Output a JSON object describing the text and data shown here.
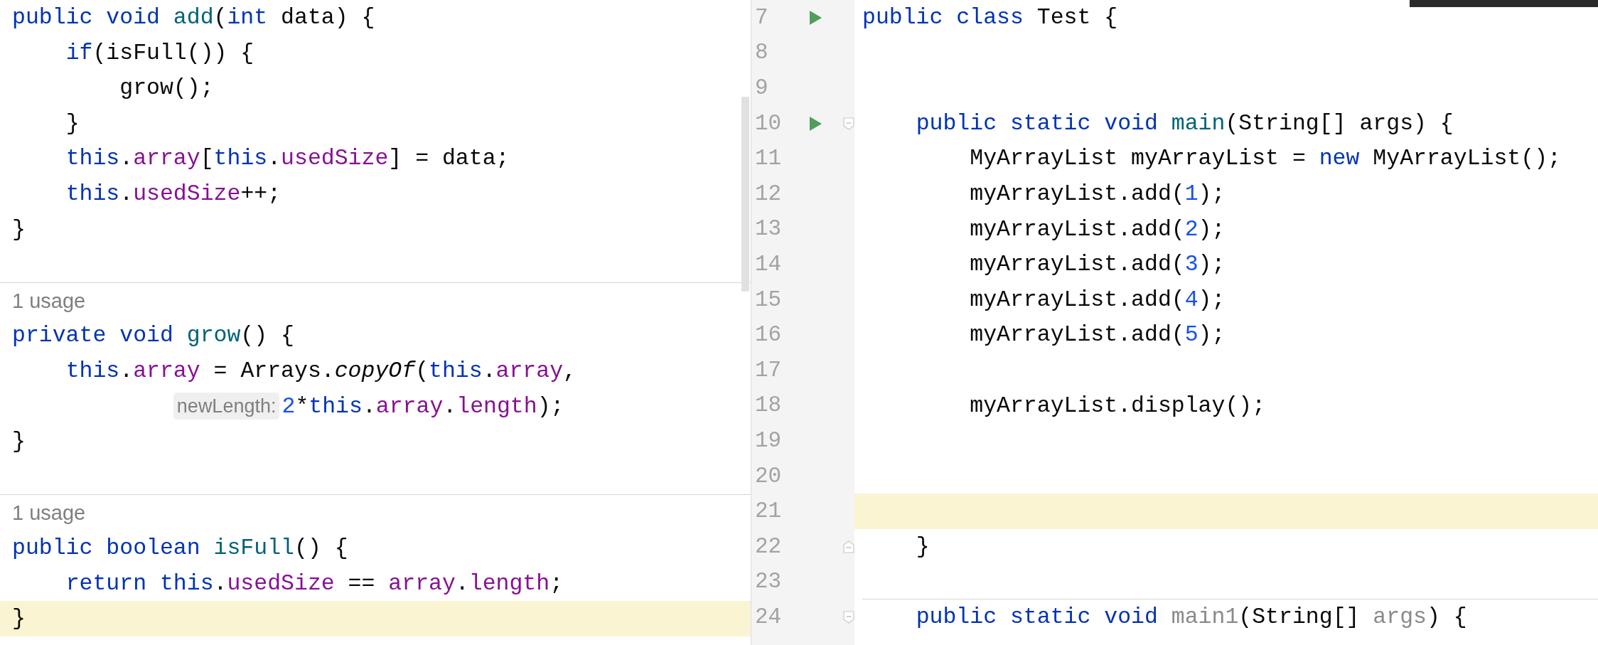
{
  "preview": {
    "blocks": [
      {
        "lines": [
          {
            "current": false,
            "tokens": [
              {
                "text": "public",
                "kind": "keyword"
              },
              {
                "text": " void",
                "kind": "keyword"
              },
              {
                "text": " add",
                "kind": "declaration"
              },
              {
                "text": "(",
                "kind": "plain"
              },
              {
                "text": "int",
                "kind": "keyword"
              },
              {
                "text": " data) {",
                "kind": "plain"
              }
            ]
          },
          {
            "current": false,
            "tokens": [
              {
                "text": "    if",
                "kind": "keyword"
              },
              {
                "text": "(isFull()) {",
                "kind": "plain"
              }
            ]
          },
          {
            "current": false,
            "tokens": [
              {
                "text": "        grow();",
                "kind": "plain"
              }
            ]
          },
          {
            "current": false,
            "tokens": [
              {
                "text": "    }",
                "kind": "plain"
              }
            ]
          },
          {
            "current": false,
            "tokens": [
              {
                "text": "    this",
                "kind": "keyword"
              },
              {
                "text": ".",
                "kind": "plain"
              },
              {
                "text": "array",
                "kind": "field"
              },
              {
                "text": "[",
                "kind": "plain"
              },
              {
                "text": "this",
                "kind": "keyword"
              },
              {
                "text": ".",
                "kind": "plain"
              },
              {
                "text": "usedSize",
                "kind": "field"
              },
              {
                "text": "] = data;",
                "kind": "plain"
              }
            ]
          },
          {
            "current": false,
            "tokens": [
              {
                "text": "    this",
                "kind": "keyword"
              },
              {
                "text": ".",
                "kind": "plain"
              },
              {
                "text": "usedSize",
                "kind": "field"
              },
              {
                "text": "++;",
                "kind": "plain"
              }
            ]
          },
          {
            "current": false,
            "tokens": [
              {
                "text": "}",
                "kind": "plain"
              }
            ]
          }
        ]
      },
      {
        "usage": "1 usage",
        "lines": [
          {
            "current": false,
            "tokens": [
              {
                "text": "private",
                "kind": "keyword"
              },
              {
                "text": " void",
                "kind": "keyword"
              },
              {
                "text": " grow",
                "kind": "declaration"
              },
              {
                "text": "() {",
                "kind": "plain"
              }
            ]
          },
          {
            "current": false,
            "tokens": [
              {
                "text": "    this",
                "kind": "keyword"
              },
              {
                "text": ".",
                "kind": "plain"
              },
              {
                "text": "array",
                "kind": "field"
              },
              {
                "text": " = Arrays.",
                "kind": "plain"
              },
              {
                "text": "copyOf",
                "kind": "static_call"
              },
              {
                "text": "(",
                "kind": "plain"
              },
              {
                "text": "this",
                "kind": "keyword"
              },
              {
                "text": ".",
                "kind": "plain"
              },
              {
                "text": "array",
                "kind": "field"
              },
              {
                "text": ",",
                "kind": "plain"
              }
            ]
          },
          {
            "current": false,
            "tokens": [
              {
                "text": "            newLength:",
                "kind": "hint"
              },
              {
                "text": "2",
                "kind": "number"
              },
              {
                "text": "*",
                "kind": "plain"
              },
              {
                "text": "this",
                "kind": "keyword"
              },
              {
                "text": ".",
                "kind": "plain"
              },
              {
                "text": "array",
                "kind": "field"
              },
              {
                "text": ".",
                "kind": "plain"
              },
              {
                "text": "length",
                "kind": "field"
              },
              {
                "text": ");",
                "kind": "plain"
              }
            ]
          },
          {
            "current": false,
            "tokens": [
              {
                "text": "}",
                "kind": "plain"
              }
            ]
          }
        ]
      },
      {
        "usage": "1 usage",
        "lines": [
          {
            "current": false,
            "tokens": [
              {
                "text": "public",
                "kind": "keyword"
              },
              {
                "text": " boolean",
                "kind": "keyword"
              },
              {
                "text": " isFull",
                "kind": "declaration"
              },
              {
                "text": "() {",
                "kind": "plain"
              }
            ]
          },
          {
            "current": false,
            "tokens": [
              {
                "text": "    return",
                "kind": "keyword"
              },
              {
                "text": " this",
                "kind": "keyword"
              },
              {
                "text": ".",
                "kind": "plain"
              },
              {
                "text": "usedSize",
                "kind": "field"
              },
              {
                "text": " == ",
                "kind": "plain"
              },
              {
                "text": "array",
                "kind": "field"
              },
              {
                "text": ".",
                "kind": "plain"
              },
              {
                "text": "length",
                "kind": "field"
              },
              {
                "text": ";",
                "kind": "plain"
              }
            ]
          },
          {
            "current": true,
            "tokens": [
              {
                "text": "}",
                "kind": "plain"
              }
            ]
          }
        ]
      }
    ]
  },
  "editor": {
    "lines": [
      {
        "number": "7",
        "run": true,
        "fold_start": false,
        "fold_end": false,
        "current": false,
        "separator_above": false,
        "tokens": [
          {
            "text": "public",
            "kind": "keyword"
          },
          {
            "text": " class",
            "kind": "keyword"
          },
          {
            "text": " Test {",
            "kind": "plain"
          }
        ]
      },
      {
        "number": "8",
        "run": false,
        "fold_start": false,
        "fold_end": false,
        "current": false,
        "separator_above": false
      },
      {
        "number": "9",
        "run": false,
        "fold_start": false,
        "fold_end": false,
        "current": false,
        "separator_above": false
      },
      {
        "number": "10",
        "run": true,
        "fold_start": true,
        "fold_end": false,
        "current": false,
        "separator_above": false,
        "tokens": [
          {
            "text": "    public",
            "kind": "keyword"
          },
          {
            "text": " static",
            "kind": "keyword"
          },
          {
            "text": " void",
            "kind": "keyword"
          },
          {
            "text": " main",
            "kind": "declaration"
          },
          {
            "text": "(String[] args) {",
            "kind": "plain"
          }
        ]
      },
      {
        "number": "11",
        "run": false,
        "fold_start": false,
        "fold_end": false,
        "current": false,
        "separator_above": false,
        "tokens": [
          {
            "text": "        MyArrayList myArrayList = ",
            "kind": "plain"
          },
          {
            "text": "new",
            "kind": "keyword"
          },
          {
            "text": " MyArrayList();",
            "kind": "plain"
          }
        ]
      },
      {
        "number": "12",
        "run": false,
        "fold_start": false,
        "fold_end": false,
        "current": false,
        "separator_above": false,
        "tokens": [
          {
            "text": "        myArrayList.add(",
            "kind": "plain"
          },
          {
            "text": "1",
            "kind": "number"
          },
          {
            "text": ");",
            "kind": "plain"
          }
        ]
      },
      {
        "number": "13",
        "run": false,
        "fold_start": false,
        "fold_end": false,
        "current": false,
        "separator_above": false,
        "tokens": [
          {
            "text": "        myArrayList.add(",
            "kind": "plain"
          },
          {
            "text": "2",
            "kind": "number"
          },
          {
            "text": ");",
            "kind": "plain"
          }
        ]
      },
      {
        "number": "14",
        "run": false,
        "fold_start": false,
        "fold_end": false,
        "current": false,
        "separator_above": false,
        "tokens": [
          {
            "text": "        myArrayList.add(",
            "kind": "plain"
          },
          {
            "text": "3",
            "kind": "number"
          },
          {
            "text": ");",
            "kind": "plain"
          }
        ]
      },
      {
        "number": "15",
        "run": false,
        "fold_start": false,
        "fold_end": false,
        "current": false,
        "separator_above": false,
        "tokens": [
          {
            "text": "        myArrayList.add(",
            "kind": "plain"
          },
          {
            "text": "4",
            "kind": "number"
          },
          {
            "text": ");",
            "kind": "plain"
          }
        ]
      },
      {
        "number": "16",
        "run": false,
        "fold_start": false,
        "fold_end": false,
        "current": false,
        "separator_above": false,
        "tokens": [
          {
            "text": "        myArrayList.add(",
            "kind": "plain"
          },
          {
            "text": "5",
            "kind": "number"
          },
          {
            "text": ");",
            "kind": "plain"
          }
        ]
      },
      {
        "number": "17",
        "run": false,
        "fold_start": false,
        "fold_end": false,
        "current": false,
        "separator_above": false
      },
      {
        "number": "18",
        "run": false,
        "fold_start": false,
        "fold_end": false,
        "current": false,
        "separator_above": false,
        "tokens": [
          {
            "text": "        myArrayList.display();",
            "kind": "plain"
          }
        ]
      },
      {
        "number": "19",
        "run": false,
        "fold_start": false,
        "fold_end": false,
        "current": false,
        "separator_above": false
      },
      {
        "number": "20",
        "run": false,
        "fold_start": false,
        "fold_end": false,
        "current": false,
        "separator_above": false
      },
      {
        "number": "21",
        "run": false,
        "fold_start": false,
        "fold_end": false,
        "current": true,
        "separator_above": false
      },
      {
        "number": "22",
        "run": false,
        "fold_start": false,
        "fold_end": true,
        "current": false,
        "separator_above": false,
        "tokens": [
          {
            "text": "    }",
            "kind": "plain"
          }
        ]
      },
      {
        "number": "23",
        "run": false,
        "fold_start": false,
        "fold_end": false,
        "current": false,
        "separator_above": false
      },
      {
        "number": "24",
        "run": false,
        "fold_start": true,
        "fold_end": false,
        "current": false,
        "separator_above": true,
        "tokens": [
          {
            "text": "    public",
            "kind": "keyword"
          },
          {
            "text": " static",
            "kind": "keyword"
          },
          {
            "text": " void",
            "kind": "keyword"
          },
          {
            "text": " main1",
            "kind": "unused"
          },
          {
            "text": "(String[] ",
            "kind": "plain"
          },
          {
            "text": "args",
            "kind": "unused"
          },
          {
            "text": ") {",
            "kind": "plain"
          }
        ]
      }
    ]
  }
}
